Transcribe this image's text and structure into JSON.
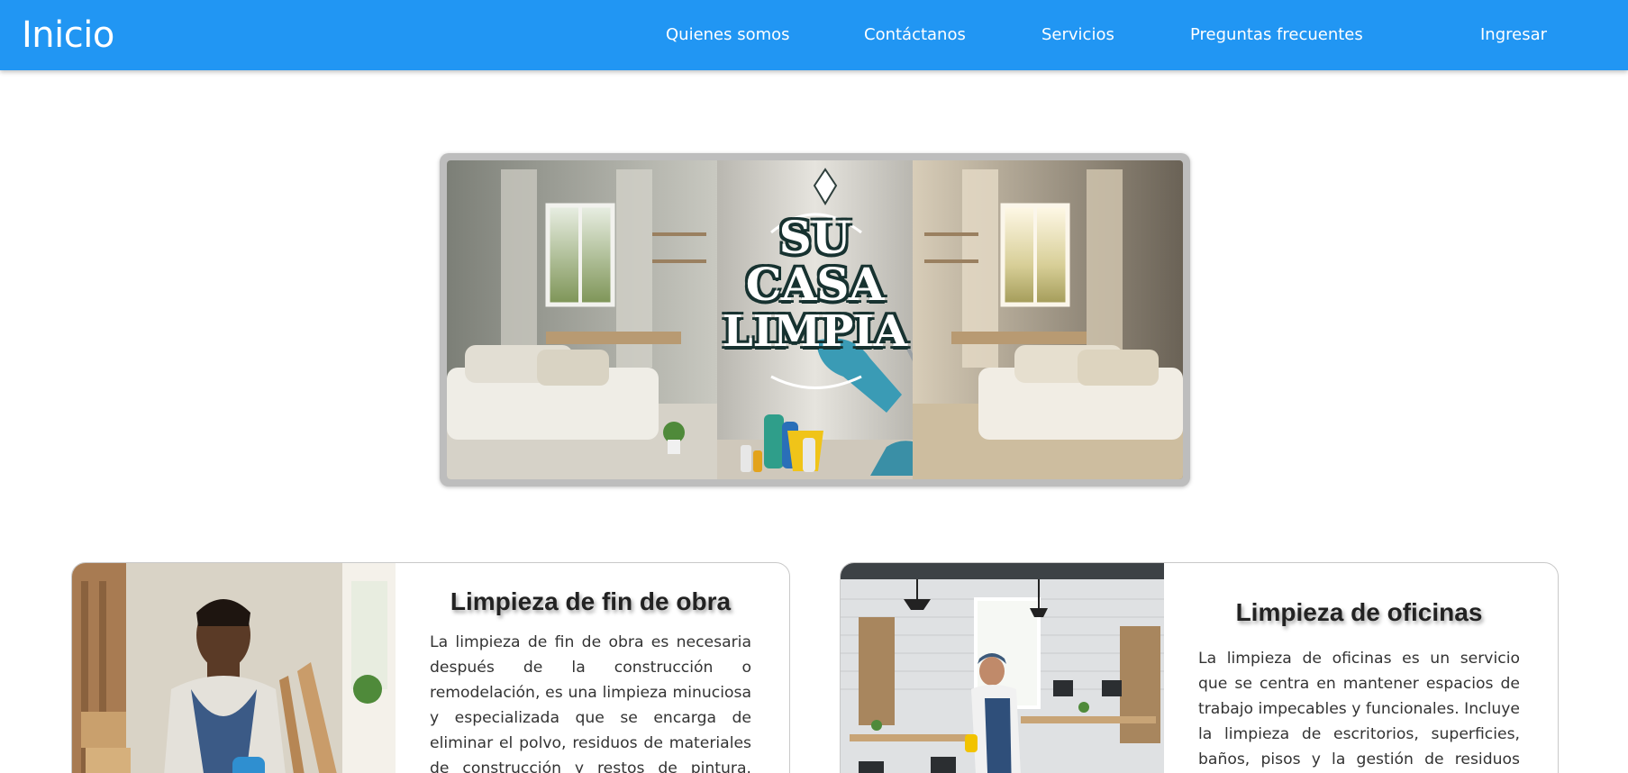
{
  "navbar": {
    "brand": "Inicio",
    "links": [
      "Quienes somos",
      "Contáctanos",
      "Servicios",
      "Preguntas frecuentes"
    ],
    "login": "Ingresar",
    "background": "#2196f3"
  },
  "hero": {
    "logo_lines": [
      "SU",
      "CASA",
      "LIMPIA"
    ]
  },
  "cards": [
    {
      "title": "Limpieza de fin de obra",
      "text": "La limpieza de fin de obra es necesaria después de la construcción o remodelación, es una limpieza minuciosa y especializada que se encarga de eliminar el polvo, residuos de materiales de construcción y restos de pintura. Aborda"
    },
    {
      "title": "Limpieza de oficinas",
      "text": "La limpieza de oficinas es un servicio que se centra en mantener espacios de trabajo impecables y funcionales. Incluye la limpieza de escritorios, superficies, baños, pisos y la gestión de residuos para"
    }
  ]
}
